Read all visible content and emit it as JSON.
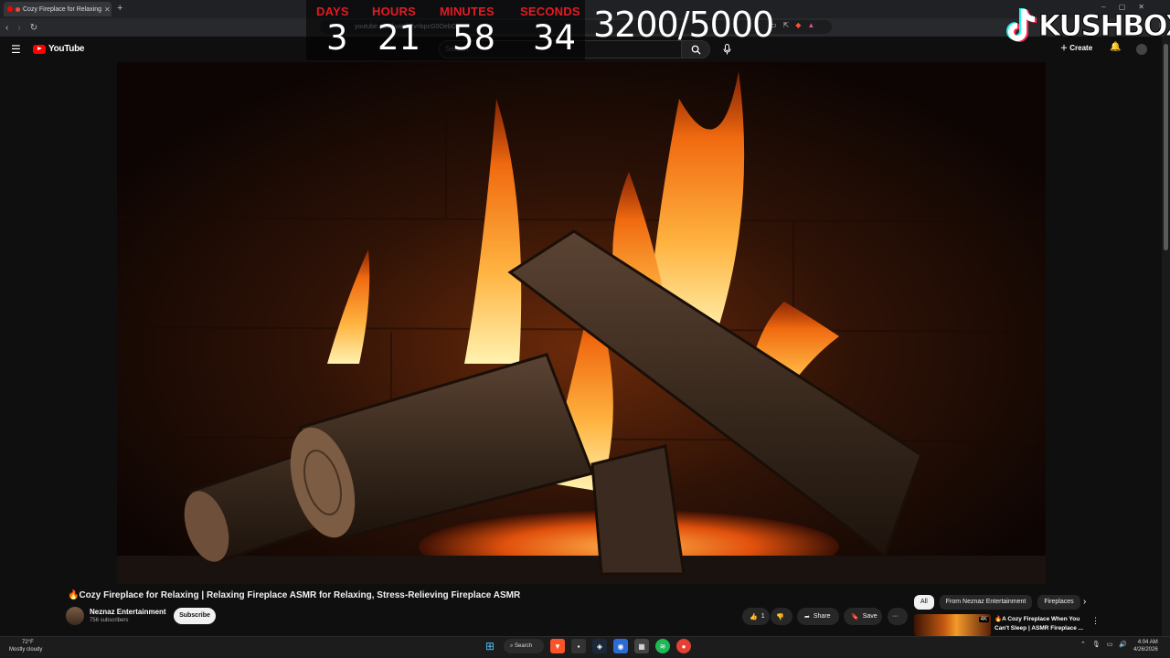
{
  "browser": {
    "tab_title": "Cozy Fireplace for Relaxing",
    "url": "youtube.com/watch?v=bpcG0OebO",
    "new_tab": "+",
    "window_controls": [
      "–",
      "▢",
      "✕"
    ]
  },
  "youtube": {
    "logo_text": "YouTube",
    "search_placeholder": "Search",
    "create_label": "Create"
  },
  "overlay": {
    "countdown": {
      "days_label": "DAYS",
      "days": "3",
      "hours_label": "HOURS",
      "hours": "21",
      "minutes_label": "MINUTES",
      "minutes": "58",
      "seconds_label": "SECONDS",
      "seconds": "34"
    },
    "goal": "3200/5000",
    "brand": "KUSHBOX",
    "label_color": "#e31b23"
  },
  "video": {
    "title": "🔥Cozy Fireplace for Relaxing | Relaxing Fireplace ASMR for Relaxing, Stress-Relieving Fireplace ASMR",
    "channel": "Neznaz Entertainment",
    "subscribers": "756 subscribers",
    "subscribe_label": "Subscribe",
    "likes": "1",
    "share_label": "Share",
    "save_label": "Save",
    "more_label": "···"
  },
  "sidebar": {
    "chips": [
      "All",
      "From Neznaz Entertainment",
      "Fireplaces"
    ],
    "recommended": {
      "title": "🔥A Cozy Fireplace When You Can't Sleep | ASMR Fireplace ...",
      "badge": "4K"
    }
  },
  "taskbar": {
    "weather_temp": "72°F",
    "weather_desc": "Mostly cloudy",
    "search_label": "Search",
    "time": "4:04 AM",
    "date": "4/26/2026"
  }
}
